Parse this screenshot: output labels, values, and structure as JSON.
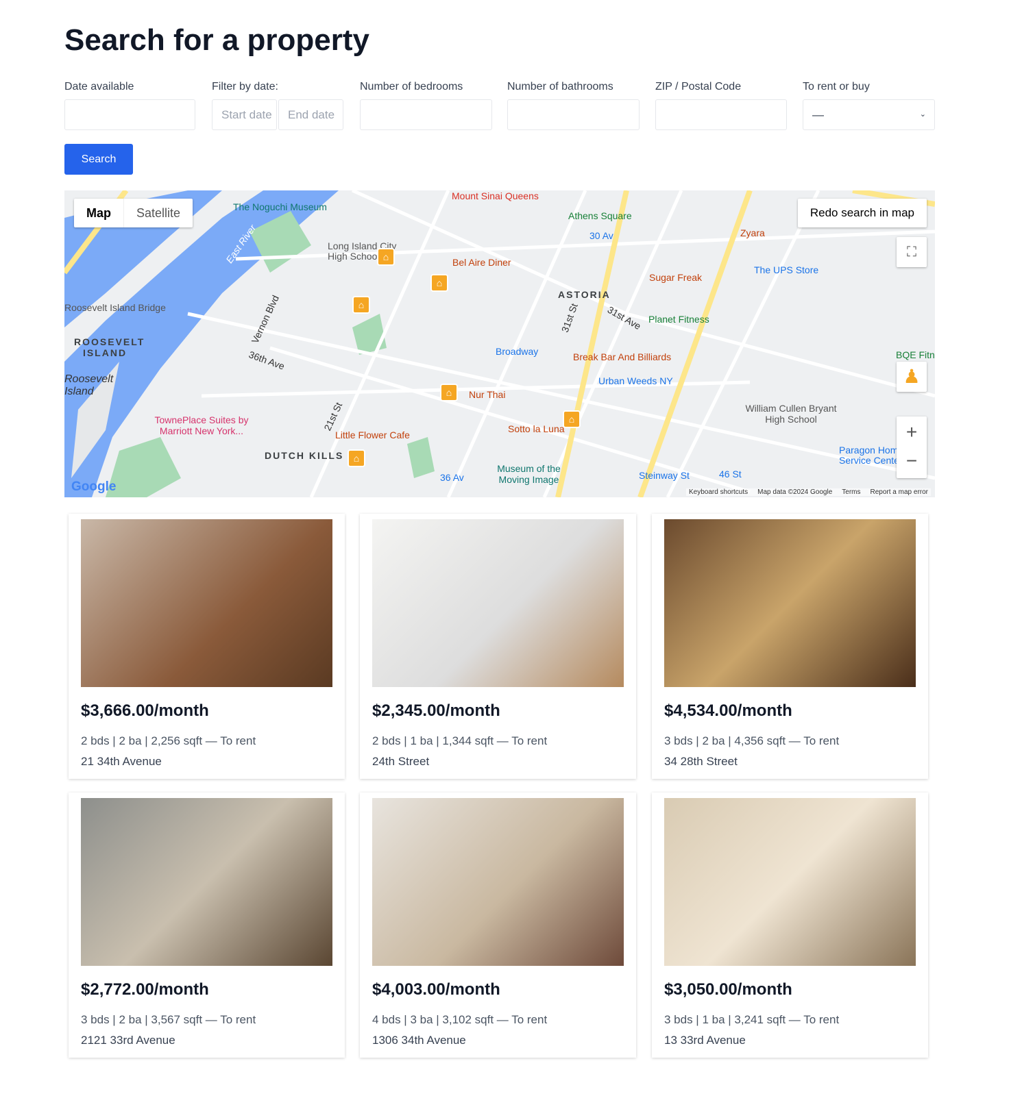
{
  "title": "Search for a property",
  "filters": {
    "date_available": {
      "label": "Date available",
      "value": ""
    },
    "filter_by_date": {
      "label": "Filter by date:",
      "start_placeholder": "Start date",
      "end_placeholder": "End date"
    },
    "bedrooms": {
      "label": "Number of bedrooms",
      "value": ""
    },
    "bathrooms": {
      "label": "Number of bathrooms",
      "value": ""
    },
    "zip": {
      "label": "ZIP / Postal Code",
      "value": ""
    },
    "rent_or_buy": {
      "label": "To rent or buy",
      "selected": "—"
    }
  },
  "search_button": "Search",
  "map": {
    "type_map": "Map",
    "type_satellite": "Satellite",
    "redo": "Redo search in map",
    "google_logo": "Google",
    "attribution": [
      "Keyboard shortcuts",
      "Map data ©2024 Google",
      "Terms",
      "Report a map error"
    ],
    "labels": [
      "The Noguchi Museum",
      "Mount Sinai Queens",
      "Athens Square",
      "30 Av",
      "Zyara",
      "Long Island City High School",
      "Bel Aire Diner",
      "The UPS Store",
      "Sugar Freak",
      "ASTORIA",
      "Planet Fitness",
      "Roosevelt Island Bridge",
      "ROOSEVELT ISLAND",
      "Roosevelt Island",
      "Broadway",
      "Break Bar And Billiards",
      "Urban Weeds NY",
      "BQE Fitness",
      "Nur Thai",
      "William Cullen Bryant High School",
      "TownePlace Suites by Marriott New York...",
      "Sotto la Luna",
      "Little Flower Cafe",
      "Paragon Home Service Center",
      "DUTCH KILLS",
      "Museum of the Moving Image",
      "36 Av",
      "Steinway St",
      "46 St",
      "East River",
      "36th Ave",
      "31st Ave",
      "Vernon Blvd",
      "21st St",
      "31st St"
    ]
  },
  "listings": [
    {
      "price": "$3,666.00/month",
      "details": "2 bds | 2 ba | 2,256 sqft — To rent",
      "address": "21 34th Avenue"
    },
    {
      "price": "$2,345.00/month",
      "details": "2 bds | 1 ba | 1,344 sqft — To rent",
      "address": "24th Street"
    },
    {
      "price": "$4,534.00/month",
      "details": "3 bds | 2 ba | 4,356 sqft — To rent",
      "address": "34 28th Street"
    },
    {
      "price": "$2,772.00/month",
      "details": "3 bds | 2 ba | 3,567 sqft — To rent",
      "address": "2121 33rd Avenue"
    },
    {
      "price": "$4,003.00/month",
      "details": "4 bds | 3 ba | 3,102 sqft — To rent",
      "address": "1306 34th Avenue"
    },
    {
      "price": "$3,050.00/month",
      "details": "3 bds | 1 ba | 3,241 sqft — To rent",
      "address": "13 33rd Avenue"
    }
  ],
  "colors": {
    "primary": "#2563eb",
    "water": "#7baaf7",
    "park": "#a8dab5",
    "pin": "#f5a623"
  }
}
